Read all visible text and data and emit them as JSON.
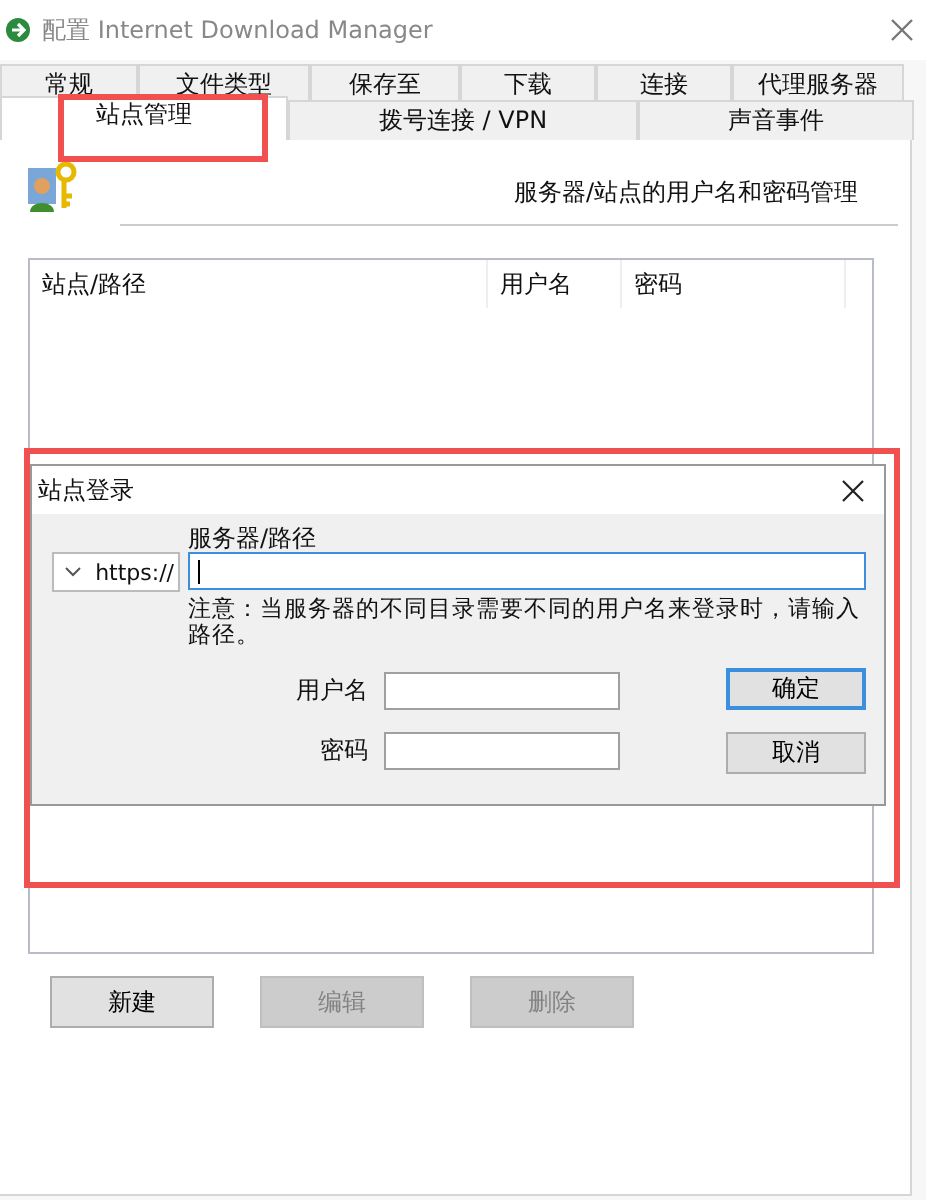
{
  "window": {
    "title": "配置 Internet Download Manager"
  },
  "tab_rows": [
    [
      {
        "label": "常规",
        "selected": false
      },
      {
        "label": "文件类型",
        "selected": false
      },
      {
        "label": "保存至",
        "selected": false
      },
      {
        "label": "下载",
        "selected": false
      },
      {
        "label": "连接",
        "selected": false
      },
      {
        "label": "代理服务器",
        "selected": false
      }
    ],
    [
      {
        "label": "站点管理",
        "selected": true
      },
      {
        "label": "拨号连接 / VPN",
        "selected": false
      },
      {
        "label": "声音事件",
        "selected": false
      }
    ]
  ],
  "header": "服务器/站点的用户名和密码管理",
  "table": {
    "columns": [
      "站点/路径",
      "用户名",
      "密码"
    ]
  },
  "buttons": [
    {
      "label": "新建",
      "disabled": false
    },
    {
      "label": "编辑",
      "disabled": true
    },
    {
      "label": "删除",
      "disabled": true
    }
  ],
  "dialog": {
    "title": "站点登录",
    "protocol": "https://",
    "path_label": "服务器/路径",
    "note": "注意：当服务器的不同目录需要不同的用户名来登录时，请输入路径。",
    "username_label": "用户名",
    "password_label": "密码",
    "buttons": [
      {
        "label": "确定",
        "default": true
      },
      {
        "label": "取消",
        "default": false
      }
    ]
  }
}
